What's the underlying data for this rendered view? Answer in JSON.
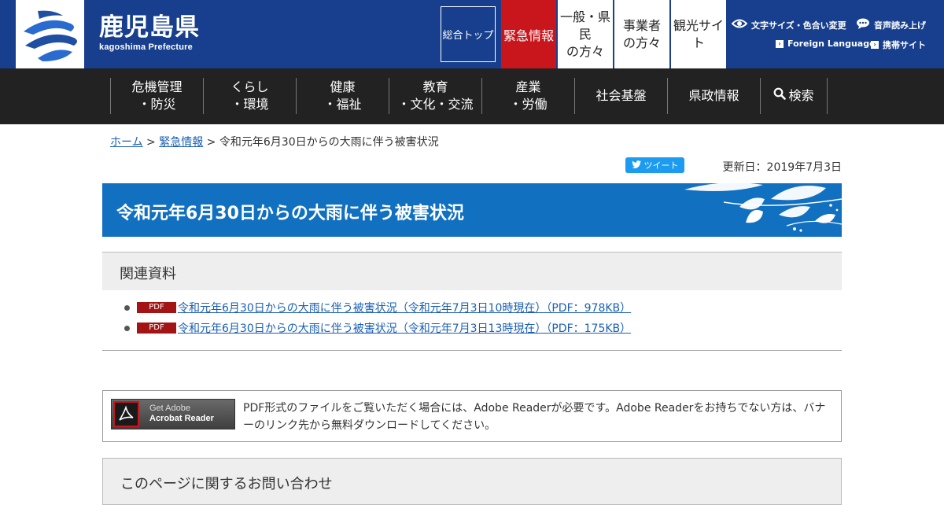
{
  "site": {
    "name_jp": "鹿児島県",
    "name_en": "kagoshima Prefecture"
  },
  "top_nav": {
    "sogo": "総合トップ",
    "kinkyu": "緊急情報",
    "kenmin_line1": "一般・県",
    "kenmin_line2": "民",
    "kenmin_line3": "の方々",
    "jigyo_line1": "事業者",
    "jigyo_line2": "の方々",
    "kanko_line1": "観光サイ",
    "kanko_line2": "ト"
  },
  "utility": {
    "font_color": "文字サイズ・色合い変更",
    "voice": "音声読み上げ",
    "foreign": "Foreign Language",
    "mobile": "携帯サイト"
  },
  "global_nav": [
    {
      "line1": "危機管理",
      "line2": "・防災"
    },
    {
      "line1": "くらし",
      "line2": "・環境"
    },
    {
      "line1": "健康",
      "line2": "・福祉"
    },
    {
      "line1": "教育",
      "line2": "・文化・交流"
    },
    {
      "line1": "産業",
      "line2": "・労働"
    },
    {
      "line1": "社会基盤",
      "line2": ""
    },
    {
      "line1": "県政情報",
      "line2": ""
    },
    {
      "line1": "検索",
      "line2": ""
    }
  ],
  "breadcrumb": {
    "home": "ホーム",
    "sep1": " > ",
    "kinkyu": "緊急情報",
    "sep2": " > ",
    "current": "令和元年6月30日からの大雨に伴う被害状況"
  },
  "tweet_label": "ツイート",
  "updated": "更新日：2019年7月3日",
  "page_title": "令和元年6月30日からの大雨に伴う被害状況",
  "related": {
    "heading": "関連資料",
    "items": [
      {
        "badge": "PDF",
        "label": "令和元年6月30日からの大雨に伴う被害状況（令和元年7月3日10時現在）（PDF：978KB）"
      },
      {
        "badge": "PDF",
        "label": "令和元年6月30日からの大雨に伴う被害状況（令和元年7月3日13時現在）（PDF：175KB）"
      }
    ]
  },
  "adobe": {
    "banner_line1": "Get Adobe",
    "banner_line2": "Acrobat Reader",
    "description": "PDF形式のファイルをご覧いただく場合には、Adobe Readerが必要です。Adobe Readerをお持ちでない方は、バナーのリンク先から無料ダウンロードしてください。"
  },
  "contact_heading": "このページに関するお問い合わせ",
  "colors": {
    "header_bg": "#173f8e",
    "emergency_red": "#c9161d",
    "gnav_bg": "#222222",
    "title_blue": "#1170c0",
    "link_blue": "#1a5fb4"
  }
}
